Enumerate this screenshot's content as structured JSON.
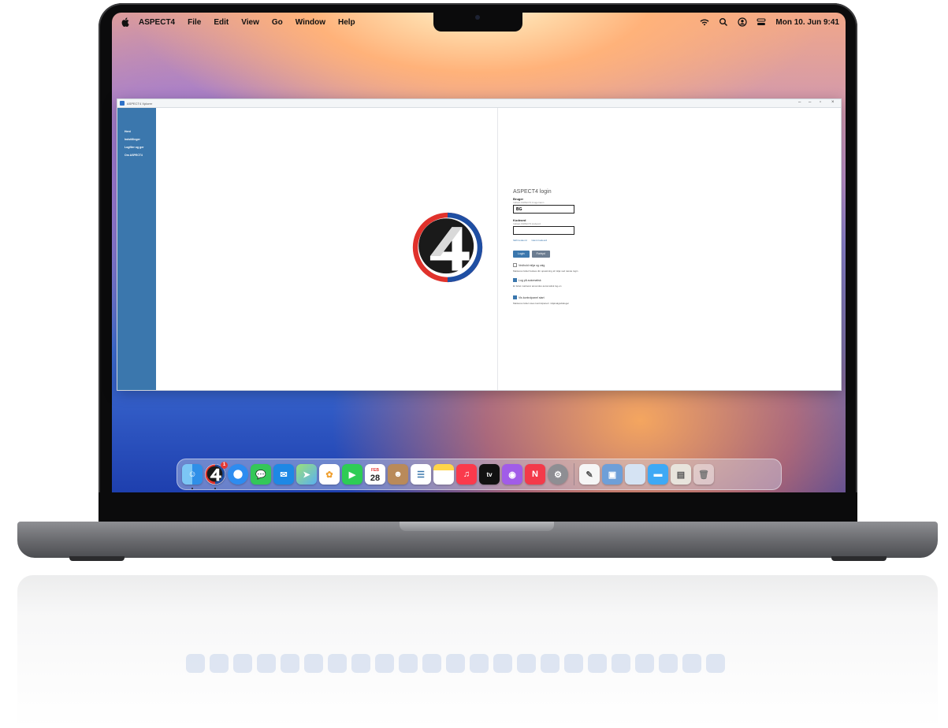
{
  "menubar": {
    "app_name": "ASPECT4",
    "menus": [
      "File",
      "Edit",
      "View",
      "Go",
      "Window",
      "Help"
    ],
    "clock": "Mon 10. Jun 9:41"
  },
  "window": {
    "title": "ASPECT4 Xplorer",
    "sidebar": [
      "Hent",
      "Indstillinger",
      "Logfiler og ger",
      "Om ASPECT4"
    ]
  },
  "login": {
    "title": "ASPECT4 login",
    "user_label": "Bruger",
    "user_hint": "Indtast ASPECT4 brugernavn",
    "user_value": "BG",
    "password_label": "Kodeord",
    "password_hint": "Indtast ASPECT4 kodeord",
    "password_value": "",
    "link_1": "Skift kodeord",
    "link_2": "Glemt kodeord",
    "login_button": "Login",
    "cancel_button": "Fortryd",
    "option_1": "Vedhold miljø og valg",
    "option_1_desc": "Markeres feltet huskes din opsætning af miljø ved næste login",
    "option_2": "Log på automatisk",
    "option_2_desc": "Er feltet markeret anvendes automatisk log-on",
    "option_3": "Vis kontrolpanel start",
    "option_3_desc": "Markeres feltet vises kontrolpanel i miljøvalgsdialoger",
    "option_1_checked": false,
    "option_2_checked": true,
    "option_3_checked": true
  },
  "dock": {
    "calendar_month": "FEB",
    "calendar_day": "28",
    "tv_label": "tv",
    "badge": "1",
    "icons": [
      "finder-icon",
      "aspect4-icon",
      "safari-icon",
      "messages-icon",
      "mail-icon",
      "maps-icon",
      "photos-icon",
      "facetime-icon",
      "calendar-icon",
      "contacts-icon",
      "reminders-icon",
      "notes-icon",
      "music-icon",
      "apple-tv-icon",
      "podcasts-icon",
      "news-icon",
      "system-settings-icon",
      "textedit-icon",
      "preview-icon",
      "generic-app-icon",
      "folder-icon",
      "archive-icon",
      "trash-icon"
    ]
  },
  "colors": {
    "sidebar": "#3b77ad",
    "primary_button": "#3b77ad",
    "logo_red": "#e0322c",
    "logo_blue": "#1f4fa3"
  }
}
